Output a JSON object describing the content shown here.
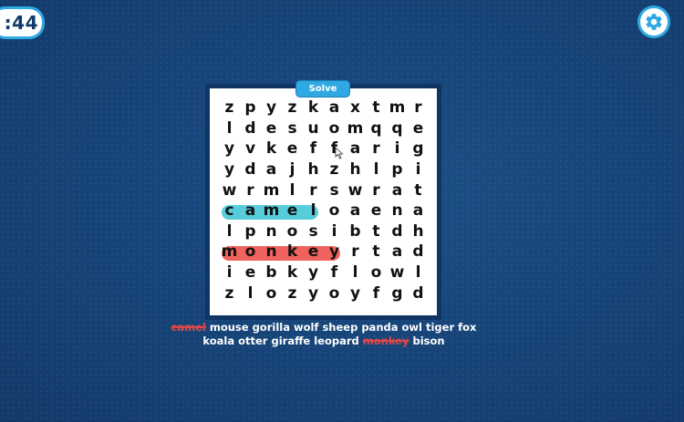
{
  "timer": {
    "display": ":44"
  },
  "settings": {
    "icon": "gear-icon"
  },
  "solve_button": {
    "label": "Solve"
  },
  "colors": {
    "background": "#17457a",
    "accent": "#2fa9e3",
    "highlight_camel": "#57cddc",
    "highlight_monkey": "#f0625d",
    "found_word": "#d7484a"
  },
  "grid": [
    [
      "z",
      "p",
      "y",
      "z",
      "k",
      "a",
      "x",
      "t",
      "m",
      "r"
    ],
    [
      "l",
      "d",
      "e",
      "s",
      "u",
      "o",
      "m",
      "q",
      "q",
      "e"
    ],
    [
      "y",
      "v",
      "k",
      "e",
      "f",
      "f",
      "a",
      "r",
      "i",
      "g"
    ],
    [
      "y",
      "d",
      "a",
      "j",
      "h",
      "z",
      "h",
      "l",
      "p",
      "i"
    ],
    [
      "w",
      "r",
      "m",
      "l",
      "r",
      "s",
      "w",
      "r",
      "a",
      "t"
    ],
    [
      "c",
      "a",
      "m",
      "e",
      "l",
      "o",
      "a",
      "e",
      "n",
      "a"
    ],
    [
      "l",
      "p",
      "n",
      "o",
      "s",
      "i",
      "b",
      "t",
      "d",
      "h"
    ],
    [
      "m",
      "o",
      "n",
      "k",
      "e",
      "y",
      "r",
      "t",
      "a",
      "d"
    ],
    [
      "i",
      "e",
      "b",
      "k",
      "y",
      "f",
      "l",
      "o",
      "w",
      "l"
    ],
    [
      "z",
      "l",
      "o",
      "z",
      "y",
      "o",
      "y",
      "f",
      "g",
      "d"
    ]
  ],
  "words_line1": [
    {
      "text": "camel",
      "found": true
    },
    {
      "text": "mouse",
      "found": false
    },
    {
      "text": "gorilla",
      "found": false
    },
    {
      "text": "wolf",
      "found": false
    },
    {
      "text": "sheep",
      "found": false
    },
    {
      "text": "panda",
      "found": false
    },
    {
      "text": "owl",
      "found": false
    },
    {
      "text": "tiger",
      "found": false
    },
    {
      "text": "fox",
      "found": false
    }
  ],
  "words_line2": [
    {
      "text": "koala",
      "found": false
    },
    {
      "text": "otter",
      "found": false
    },
    {
      "text": "giraffe",
      "found": false
    },
    {
      "text": "leopard",
      "found": false
    },
    {
      "text": "monkey",
      "found": true
    },
    {
      "text": "bison",
      "found": false
    }
  ]
}
